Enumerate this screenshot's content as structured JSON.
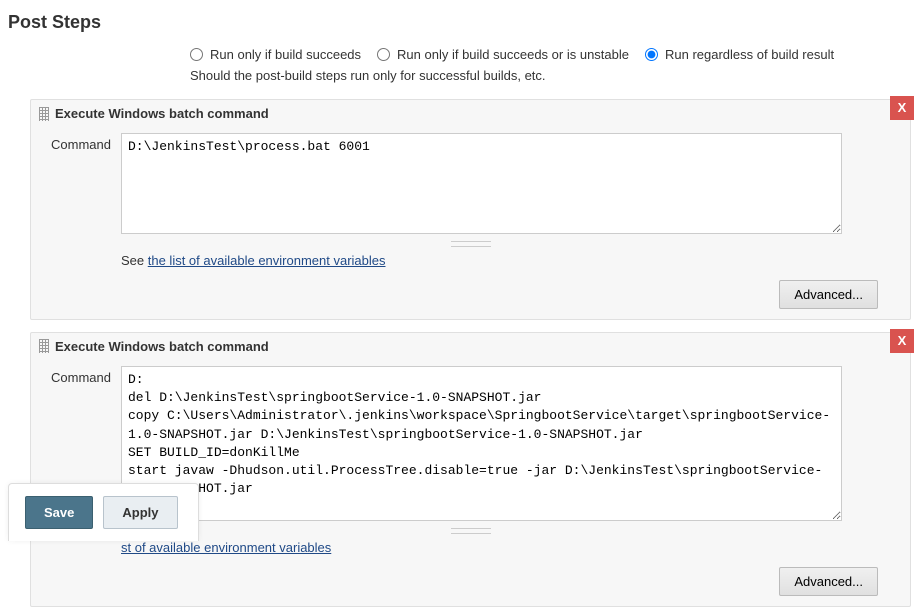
{
  "section": {
    "title": "Post Steps"
  },
  "radios": {
    "opt1": "Run only if build succeeds",
    "opt2": "Run only if build succeeds or is unstable",
    "opt3": "Run regardless of build result",
    "selected": "opt3"
  },
  "help_line": "Should the post-build steps run only for successful builds, etc.",
  "steps": [
    {
      "title": "Execute Windows batch command",
      "command_label": "Command",
      "command_value": "D:\\JenkinsTest\\process.bat 6001",
      "rows": 5,
      "env_prefix": "See ",
      "env_link": "the list of available environment variables",
      "advanced": "Advanced...",
      "delete": "X"
    },
    {
      "title": "Execute Windows batch command",
      "command_label": "Command",
      "command_value": "D:\ndel D:\\JenkinsTest\\springbootService-1.0-SNAPSHOT.jar\ncopy C:\\Users\\Administrator\\.jenkins\\workspace\\SpringbootService\\target\\springbootService-1.0-SNAPSHOT.jar D:\\JenkinsTest\\springbootService-1.0-SNAPSHOT.jar\nSET BUILD_ID=donKillMe\nstart javaw -Dhudson.util.ProcessTree.disable=true -jar D:\\JenkinsTest\\springbootService-1.0-SNAPSHOT.jar",
      "rows": 8,
      "env_prefix": "",
      "env_link": "st of available environment variables",
      "advanced": "Advanced...",
      "delete": "X"
    }
  ],
  "buttons": {
    "save": "Save",
    "apply": "Apply"
  },
  "help_icon": "?"
}
